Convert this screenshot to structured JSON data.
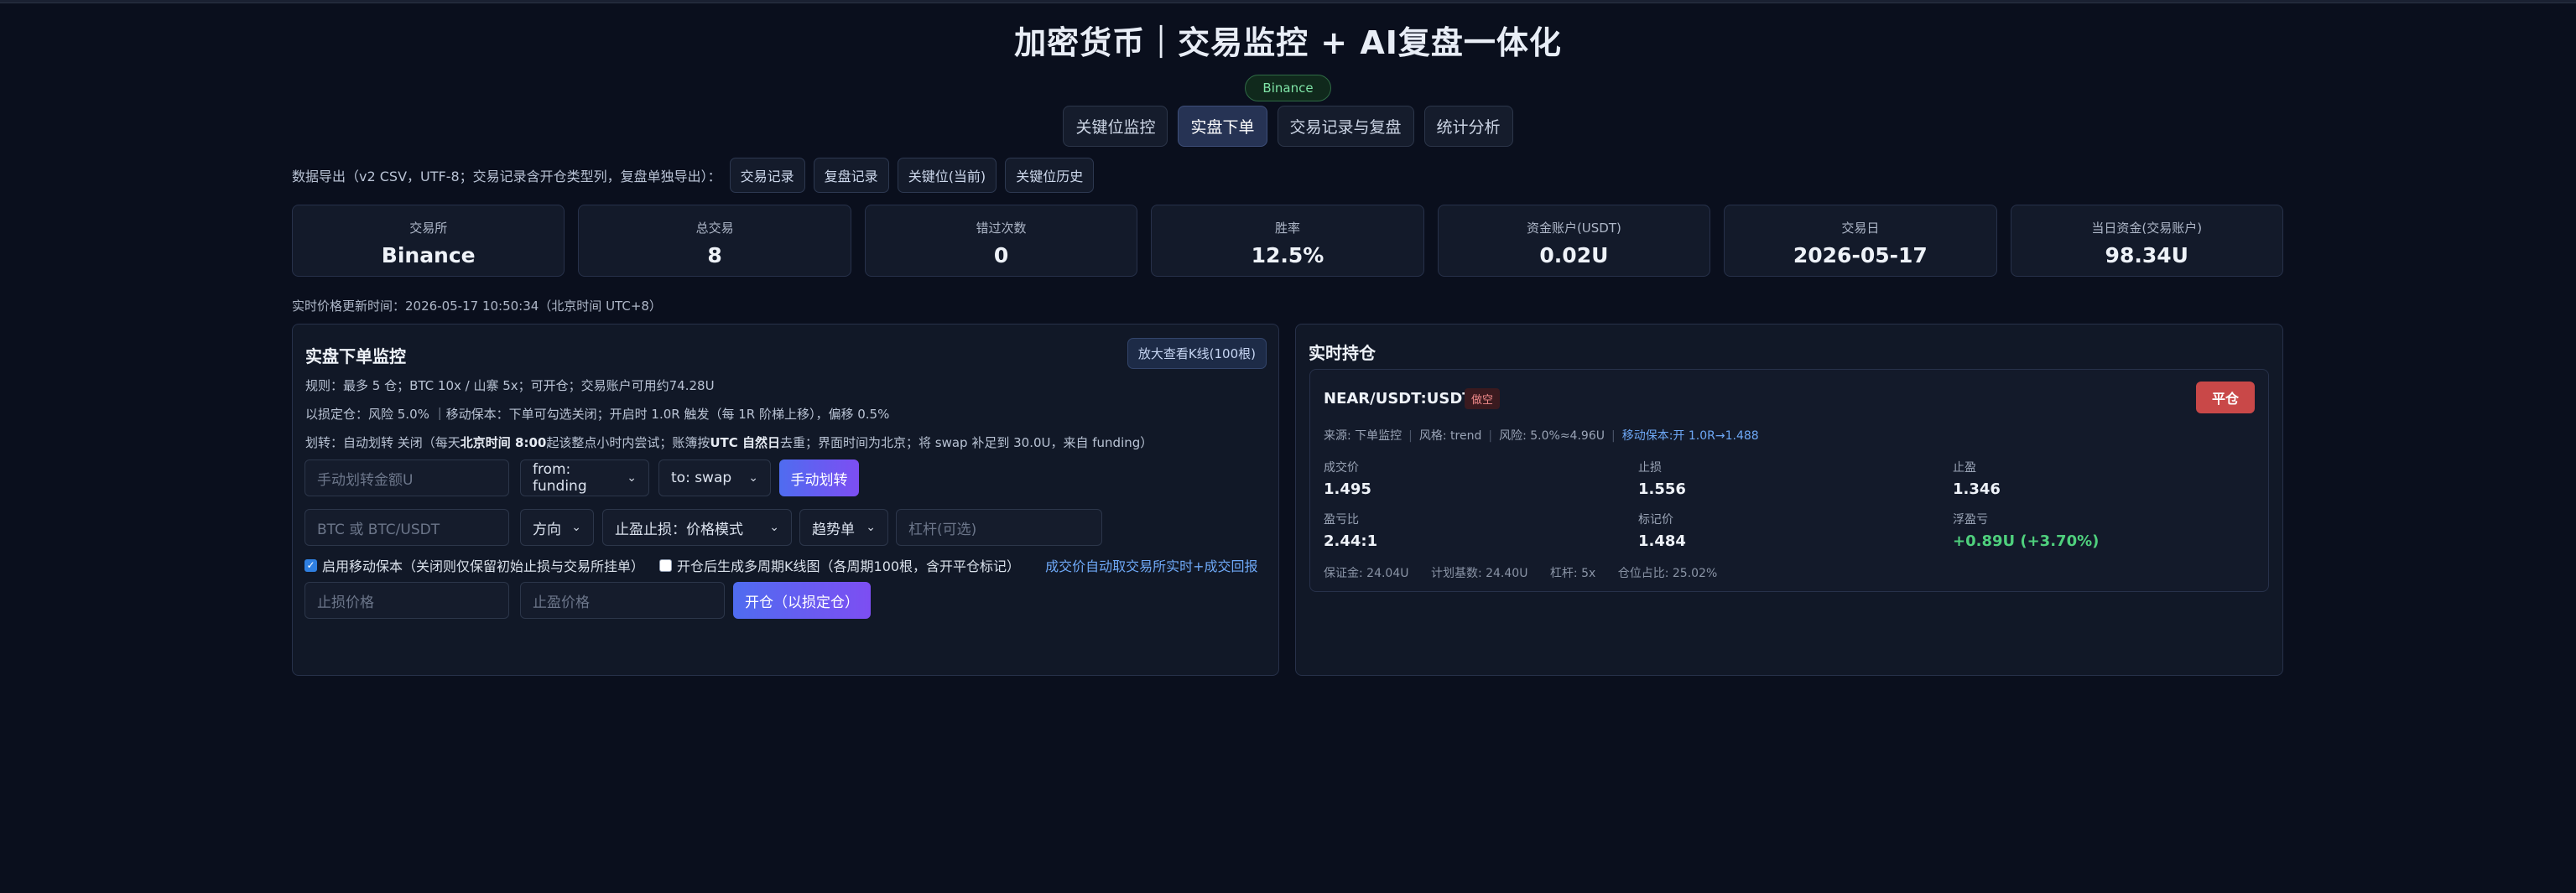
{
  "header": {
    "title": "加密货币｜交易监控 + AI复盘一体化",
    "exchange_badge": "Binance"
  },
  "tabs": [
    {
      "label": "关键位监控",
      "active": false
    },
    {
      "label": "实盘下单",
      "active": true
    },
    {
      "label": "交易记录与复盘",
      "active": false
    },
    {
      "label": "统计分析",
      "active": false
    }
  ],
  "export": {
    "label": "数据导出（v2 CSV，UTF-8；交易记录含开仓类型列，复盘单独导出）：",
    "buttons": [
      "交易记录",
      "复盘记录",
      "关键位(当前)",
      "关键位历史"
    ]
  },
  "stats": [
    {
      "label": "交易所",
      "value": "Binance"
    },
    {
      "label": "总交易",
      "value": "8"
    },
    {
      "label": "错过次数",
      "value": "0"
    },
    {
      "label": "胜率",
      "value": "12.5%"
    },
    {
      "label": "资金账户(USDT)",
      "value": "0.02U"
    },
    {
      "label": "交易日",
      "value": "2026-05-17"
    },
    {
      "label": "当日资金(交易账户)",
      "value": "98.34U"
    }
  ],
  "price_updated": "实时价格更新时间：2026-05-17 10:50:34（北京时间 UTC+8）",
  "order_panel": {
    "title": "实盘下单监控",
    "kline_button": "放大查看K线(100根)",
    "rule1": "规则：最多 5 仓；BTC 10x / 山寨 5x；可开仓；交易账户可用约74.28U",
    "rule2": "以损定仓：风险 5.0% ｜移动保本：下单可勾选关闭；开启时 1.0R 触发（每 1R 阶梯上移），偏移 0.5%",
    "rule3_pre": "划转：自动划转 关闭（每天",
    "rule3_bold1": "北京时间 8:00",
    "rule3_mid": "起该整点小时内尝试；账簿按",
    "rule3_bold2": "UTC 自然日",
    "rule3_post": "去重；界面时间为北京；将 swap 补足到 30.0U，来自 funding）",
    "transfer_amount_placeholder": "手动划转金额U",
    "from_select": "from: funding",
    "to_select": "to: swap",
    "transfer_button": "手动划转",
    "symbol_placeholder": "BTC 或 BTC/USDT",
    "direction_select": "方向",
    "tpsl_select": "止盈止损：价格模式",
    "trend_select": "趋势单",
    "leverage_placeholder": "杠杆(可选)",
    "check_move_be": "启用移动保本（关闭则仅保留初始止损与交易所挂单）",
    "check_kline": "开仓后生成多周期K线图（各周期100根，含开平仓标记）",
    "fill_note": "成交价自动取交易所实时+成交回报",
    "sl_placeholder": "止损价格",
    "tp_placeholder": "止盈价格",
    "open_button": "开仓（以损定仓）"
  },
  "positions_panel": {
    "title": "实时持仓",
    "position": {
      "symbol": "NEAR/USDT:USDT",
      "side_badge": "做空",
      "close_button": "平仓",
      "meta_source": "来源: 下单监控",
      "meta_style": "风格: trend",
      "meta_risk": "风险: 5.0%≈4.96U",
      "meta_move": "移动保本:开 1.0R→1.488",
      "fill_label": "成交价",
      "fill_value": "1.495",
      "sl_label": "止损",
      "sl_value": "1.556",
      "tp_label": "止盈",
      "tp_value": "1.346",
      "rr_label": "盈亏比",
      "rr_value": "2.44:1",
      "mark_label": "标记价",
      "mark_value": "1.484",
      "pnl_label": "浮盈亏",
      "pnl_value": "+0.89U (+3.70%)",
      "margin": "保证金: 24.04U",
      "plan": "计划基数: 24.40U",
      "leverage": "杠杆: 5x",
      "ratio": "仓位占比: 25.02%"
    }
  },
  "colors": {
    "accent": "#4f6cf0",
    "profit": "#4fd07d",
    "short": "#f08a8a",
    "close": "#c94848"
  }
}
